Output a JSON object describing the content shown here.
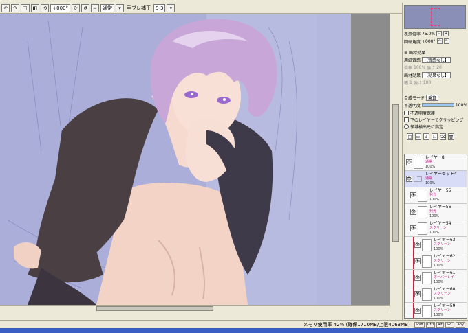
{
  "toolbar": {
    "rotation_value": "+000°",
    "blend_mode": "通常",
    "stabilizer_label": "手ブレ補正",
    "stabilizer_value": "S-3"
  },
  "navigator": {
    "zoom_label": "表示倍率",
    "zoom_value": "75.0%",
    "angle_label": "回転角度",
    "angle_value": "+000°"
  },
  "material_effect": {
    "title": "画材効果",
    "texture_label": "用紙質感",
    "texture_value": "【質感なし】",
    "texture_scale_label": "倍率",
    "texture_scale_value": "100%",
    "texture_strength_label": "強さ",
    "texture_strength_value": "20",
    "effect_label": "画材効果",
    "effect_value": "【効果なし】",
    "effect_width_label": "幅",
    "effect_width_value": "1",
    "effect_strength_label": "強さ",
    "effect_strength_value": "100"
  },
  "layer_props": {
    "blend_label": "合成モード",
    "blend_value": "乗算",
    "opacity_label": "不透明度",
    "opacity_value": "100%",
    "opacity_level": 1.0,
    "preserve_opacity": "不透明度保護",
    "clip_label": "下のレイヤーでクリッピング",
    "selection_source": "領域検出元に指定"
  },
  "layers": [
    {
      "name": "レイヤー8",
      "mode": "通常",
      "opacity": "100%",
      "type": "normal",
      "clipped": false
    },
    {
      "name": "レイヤーセット4",
      "mode": "通常",
      "opacity": "100%",
      "type": "folder",
      "clipped": false
    },
    {
      "name": "レイヤー55",
      "mode": "発光",
      "opacity": "100%",
      "type": "normal",
      "clipped": false
    },
    {
      "name": "レイヤー56",
      "mode": "発光",
      "opacity": "100%",
      "type": "normal",
      "clipped": false
    },
    {
      "name": "レイヤー54",
      "mode": "スクリーン",
      "opacity": "100%",
      "type": "normal",
      "clipped": false
    },
    {
      "name": "レイヤー63",
      "mode": "スクリーン",
      "opacity": "100%",
      "type": "normal",
      "clipped": true
    },
    {
      "name": "レイヤー62",
      "mode": "スクリーン",
      "opacity": "100%",
      "type": "normal",
      "clipped": true
    },
    {
      "name": "レイヤー61",
      "mode": "オーバーレイ",
      "opacity": "100%",
      "type": "normal",
      "clipped": true
    },
    {
      "name": "レイヤー60",
      "mode": "スクリーン",
      "opacity": "100%",
      "type": "normal",
      "clipped": true
    },
    {
      "name": "レイヤー59",
      "mode": "スクリーン",
      "opacity": "100%",
      "type": "normal",
      "clipped": true
    }
  ],
  "status": {
    "memory": "メモリ使用率 42% (確保1710MB/上限4063MB)",
    "buttons": [
      "Shift",
      "Ctrl",
      "Alt",
      "SPC",
      "Any"
    ]
  },
  "colors": {
    "canvas_bg": "#a8acd6",
    "panel_bg": "#ece9d8",
    "accent": "#d0148c",
    "clip": "#d02040"
  }
}
